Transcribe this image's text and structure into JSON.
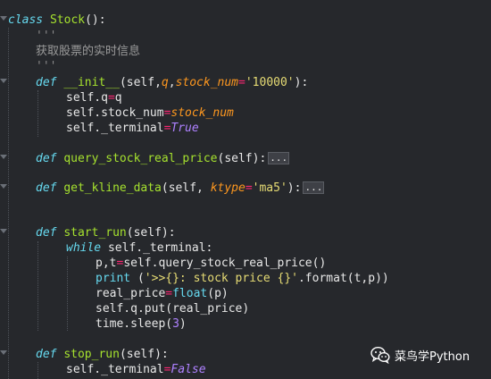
{
  "code": {
    "class_kw": "class",
    "class_name": "Stock",
    "class_paren": "():",
    "docstring_open": "'''",
    "docstring_text": "获取股票的实时信息",
    "docstring_close": "'''",
    "def_kw": "def",
    "init_name": "__init__",
    "init_open": "(self,",
    "init_q": "q",
    "init_comma": ",",
    "init_param": "stock_num",
    "init_eq": "=",
    "init_default": "'10000'",
    "init_close": "):",
    "assign_q_lhs": "self.q",
    "assign_q_eq": "=",
    "assign_q_rhs": "q",
    "assign_num_lhs": "self.stock_num",
    "assign_num_eq": "=",
    "assign_num_rhs": "stock_num",
    "assign_term_lhs": "self._terminal",
    "assign_term_eq": "=",
    "assign_term_rhs": "True",
    "query_name": "query_stock_real_price",
    "query_args": "(self):",
    "fold_marker": "...",
    "kline_name": "get_kline_data",
    "kline_open": "(self, ",
    "kline_param": "ktype",
    "kline_eq": "=",
    "kline_default": "'ma5'",
    "kline_close": "):",
    "start_name": "start_run",
    "start_args": "(self):",
    "while_kw": "while",
    "while_cond": " self._terminal:",
    "pt_lhs": "p,t",
    "pt_eq": "=",
    "pt_rhs": "self.query_stock_real_price()",
    "print_kw": "print",
    "print_open": " (",
    "print_str": "'>>{}: stock price {}'",
    "print_rest": ".format(t,p))",
    "rp_lhs": "real_price",
    "rp_eq": "=",
    "rp_fn": "float",
    "rp_args": "(p)",
    "put_call": "self.q.put(real_price)",
    "sleep_call": "time.sleep(",
    "sleep_num": "3",
    "sleep_close": ")",
    "stop_name": "stop_run",
    "stop_args": "(self):",
    "stop_lhs": "self._terminal",
    "stop_eq": "=",
    "stop_rhs": "False"
  },
  "watermark": {
    "text": "菜鸟学Python",
    "icon": "wechat-icon"
  }
}
